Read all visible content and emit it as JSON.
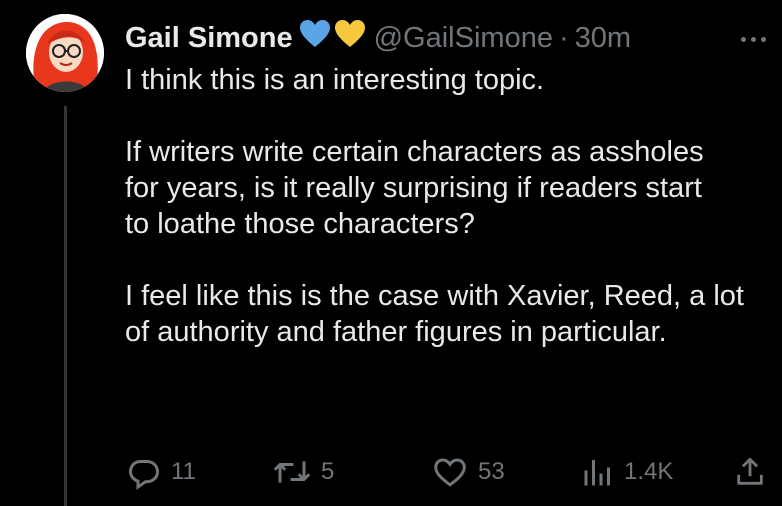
{
  "tweet": {
    "author_name": "Gail Simone",
    "handle": "@GailSimone",
    "separator": "·",
    "time": "30m",
    "badge_colors": [
      "#5ba4e6",
      "#f6c83d"
    ],
    "paragraphs": [
      "I think this is an interesting topic.",
      "If writers write certain characters as assholes for years, is it really surprising if readers start to loathe those characters?",
      "I feel like this is the case with Xavier, Reed, a lot of authority and father figures in particular."
    ]
  },
  "actions": {
    "replies": "11",
    "reposts": "5",
    "likes": "53",
    "views": "1.4K",
    "reply_icon": "reply-icon",
    "repost_icon": "repost-icon",
    "like_icon": "heart-icon",
    "views_icon": "bar-chart-icon",
    "share_icon": "share-icon"
  },
  "colors": {
    "background": "#000000",
    "text": "#e7e9ea",
    "muted": "#71767b",
    "avatar_hair": "#e8371d"
  }
}
